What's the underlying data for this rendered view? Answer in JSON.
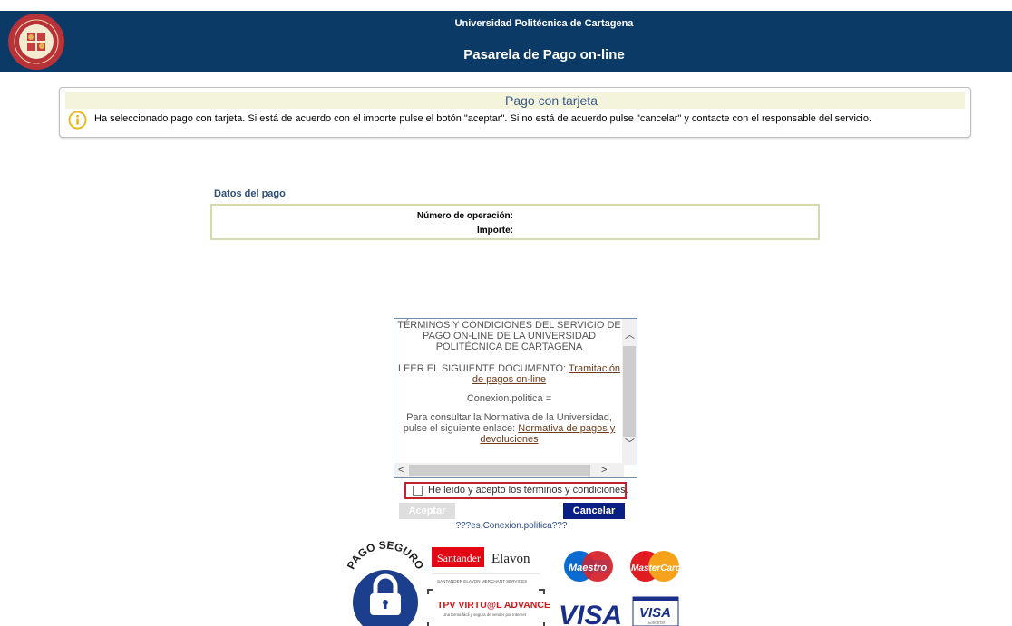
{
  "header": {
    "university": "Universidad Politécnica de Cartagena",
    "title": "Pasarela de Pago on-line",
    "bg_color": "#0c3a66"
  },
  "notice": {
    "title": "Pago con tarjeta",
    "icon": "info-icon",
    "text": "Ha seleccionado pago con tarjeta. Si está de acuerdo con el importe pulse el botón \"aceptar\". Si no está de acuerdo pulse \"cancelar\" y contacte con el responsable del servicio."
  },
  "payment": {
    "section_title": "Datos del pago",
    "operation_label": "Número de operación:",
    "amount_label": "Importe:"
  },
  "terms": {
    "heading": "TÉRMINOS Y CONDICIONES DEL SERVICIO DE PAGO ON-LINE DE LA UNIVERSIDAD POLITÉCNICA DE CARTAGENA",
    "read_prefix": "LEER EL SIGUIENTE DOCUMENTO: ",
    "read_link": "Tramitación de pagos on-line",
    "politica_text": "Conexion.politica =",
    "normativa_prefix": "Para consultar la Normativa de la Universidad, pulse el siguiente enlace: ",
    "normativa_link": "Normativa de pagos y devoluciones"
  },
  "accept": {
    "checkbox_label": "He leído y acepto los términos y condiciones.",
    "checked": false
  },
  "buttons": {
    "accept_label": "Aceptar",
    "cancel_label": "Cancelar"
  },
  "politica_footer": "???es.Conexion.politica???",
  "logos": {
    "pago_seguro": "PAGO SEGURO",
    "santander": "Santander",
    "elavon": "Elavon",
    "santander_elavon_caption": "SANTANDER ELAVON MERCHANT SERVICES",
    "tpv": "TPV VIRTU@L ADVANCE",
    "tpv_caption": "Una forma fácil y segura de vender por Internet",
    "maestro": "Maestro",
    "mastercard": "MasterCard",
    "visa": "VISA",
    "visa_electron": "VISA",
    "visa_electron_sub": "Electron"
  }
}
